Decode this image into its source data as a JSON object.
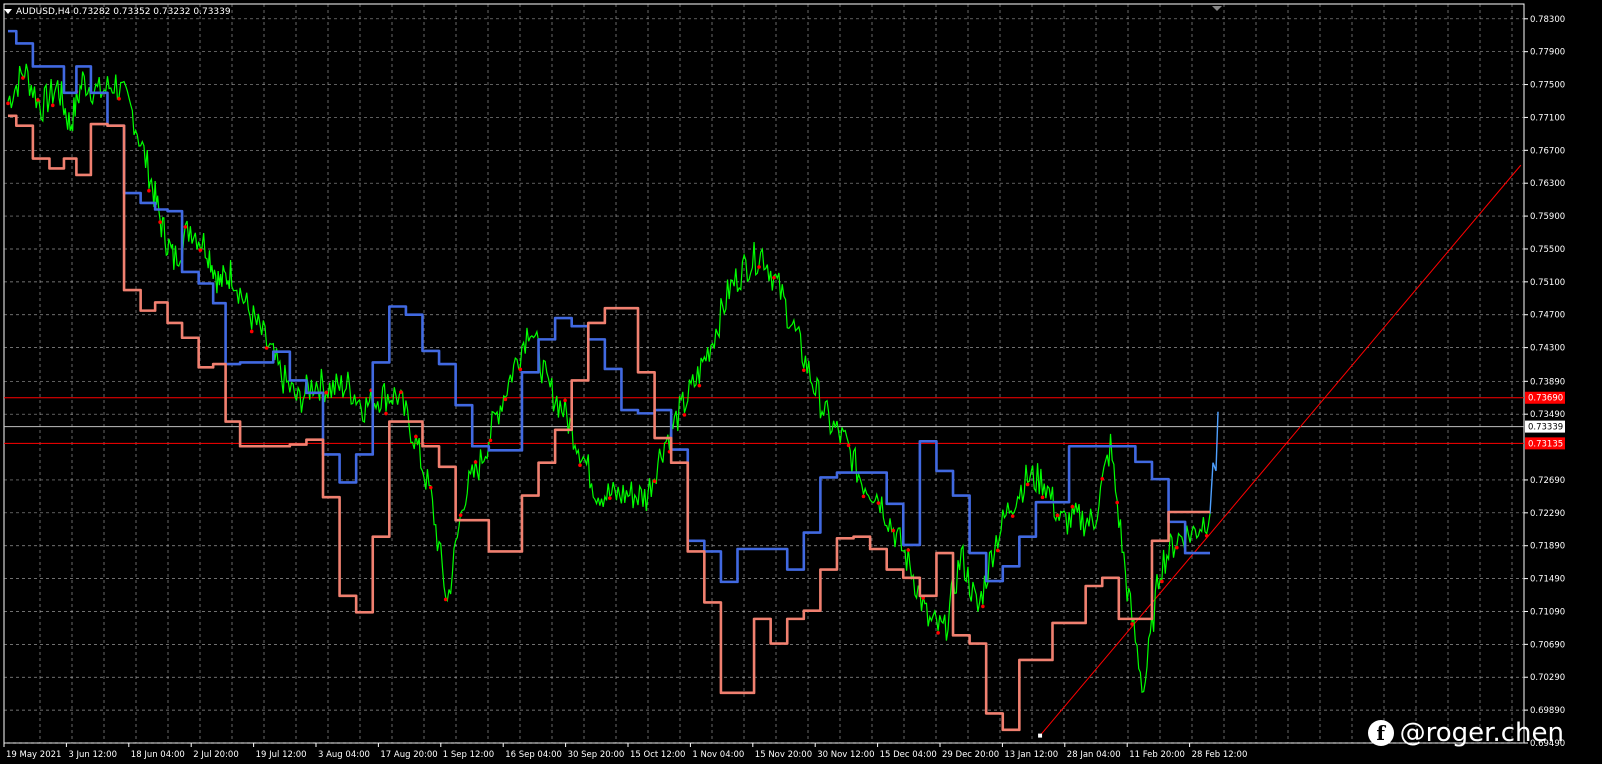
{
  "header": {
    "symbol": "AUDUSD,H4",
    "ohlc": "0.73282 0.73352 0.73232 0.73339"
  },
  "watermark": {
    "icon": "facebook-icon",
    "text": "@roger.chen"
  },
  "colors": {
    "background": "#000000",
    "grid": "#c8c8c8",
    "upper_channel": "#4169e1",
    "lower_channel": "#f08070",
    "price": "#00ff00",
    "signal_dots": "#ff0000",
    "hline": "#ff0000",
    "current_price": "#c0c0c0",
    "trendline": "#ff0000"
  },
  "chart_data": {
    "type": "line",
    "title": "",
    "xlabel": "",
    "ylabel": "",
    "ylim": [
      0.6949,
      0.7848
    ],
    "yticks": [
      "0.78300",
      "0.77900",
      "0.77500",
      "0.77100",
      "0.76700",
      "0.76300",
      "0.75900",
      "0.75500",
      "0.75100",
      "0.74700",
      "0.74300",
      "0.73890",
      "0.73490",
      "0.72690",
      "0.72290",
      "0.71890",
      "0.71490",
      "0.71090",
      "0.70690",
      "0.70290",
      "0.69890",
      "0.69490"
    ],
    "ytick_values": [
      0.783,
      0.779,
      0.775,
      0.771,
      0.767,
      0.763,
      0.759,
      0.755,
      0.751,
      0.747,
      0.743,
      0.7389,
      0.7349,
      0.7269,
      0.7229,
      0.7189,
      0.7149,
      0.7109,
      0.7069,
      0.7029,
      0.6989,
      0.6949
    ],
    "xticks": [
      "19 May 2021",
      "3 Jun 12:00",
      "18 Jun 04:00",
      "2 Jul 20:00",
      "19 Jul 12:00",
      "3 Aug 04:00",
      "17 Aug 20:00",
      "1 Sep 12:00",
      "16 Sep 04:00",
      "30 Sep 20:00",
      "15 Oct 12:00",
      "1 Nov 04:00",
      "15 Nov 20:00",
      "30 Nov 12:00",
      "15 Dec 04:00",
      "29 Dec 20:00",
      "13 Jan 12:00",
      "28 Jan 04:00",
      "11 Feb 20:00",
      "28 Feb 12:00"
    ],
    "x_index_max": 300,
    "grid": true,
    "horizontal_lines": [
      {
        "label": "0.73690",
        "value": 0.7369,
        "color": "#ff0000"
      },
      {
        "label": "0.73339",
        "value": 0.73339,
        "color": "#c0c0c0"
      },
      {
        "label": "0.73135",
        "value": 0.73135,
        "color": "#ff0000"
      }
    ],
    "trendline": {
      "from": [
        249,
        0.6958
      ],
      "to": [
        365,
        0.7652
      ]
    },
    "series": [
      {
        "key": "price",
        "color": "#00ff00",
        "x": [
          0,
          4,
          8,
          12,
          15,
          18,
          22,
          26,
          30,
          34,
          37,
          40,
          44,
          48,
          51,
          54,
          58,
          62,
          66,
          70,
          74,
          78,
          82,
          86,
          90,
          94,
          98,
          102,
          106,
          110,
          114,
          118,
          122,
          126,
          130,
          134,
          138,
          142,
          146,
          150,
          154,
          158,
          162,
          166,
          170,
          174,
          178,
          182,
          186,
          190,
          194,
          198,
          202,
          206,
          210,
          214,
          218,
          222,
          226,
          230,
          234,
          238,
          242,
          246,
          250,
          254,
          258,
          262,
          266,
          270,
          274,
          278,
          282,
          286,
          290
        ],
        "y": [
          0.773,
          0.7768,
          0.7722,
          0.7748,
          0.77,
          0.7755,
          0.774,
          0.7752,
          0.7716,
          0.7644,
          0.758,
          0.7536,
          0.7578,
          0.7552,
          0.7508,
          0.7522,
          0.7475,
          0.744,
          0.7395,
          0.7365,
          0.7388,
          0.738,
          0.7384,
          0.7358,
          0.7372,
          0.7372,
          0.7322,
          0.725,
          0.712,
          0.725,
          0.729,
          0.735,
          0.7405,
          0.746,
          0.7385,
          0.7354,
          0.7308,
          0.7255,
          0.725,
          0.7252,
          0.7248,
          0.731,
          0.735,
          0.739,
          0.744,
          0.75,
          0.753,
          0.7545,
          0.7502,
          0.7447,
          0.739,
          0.734,
          0.7315,
          0.7268,
          0.725,
          0.7205,
          0.716,
          0.7097,
          0.7085,
          0.7178,
          0.711,
          0.7192,
          0.724,
          0.7272,
          0.7268,
          0.7218,
          0.7222,
          0.7218,
          0.731,
          0.7138,
          0.7012,
          0.7165,
          0.7198,
          0.7205,
          0.7228
        ]
      },
      {
        "key": "upper",
        "color": "#4169e1",
        "x": [
          0,
          4,
          8,
          12,
          15,
          18,
          22,
          26,
          30,
          34,
          37,
          40,
          44,
          48,
          51,
          54,
          58,
          62,
          66,
          70,
          74,
          78,
          82,
          86,
          90,
          94,
          98,
          102,
          106,
          110,
          114,
          118,
          122,
          126,
          130,
          134,
          138,
          142,
          146,
          150,
          154,
          158,
          162,
          166,
          170,
          174,
          178,
          182,
          186,
          190,
          194,
          198,
          202,
          206,
          210,
          214,
          218,
          222,
          226,
          230,
          234,
          238,
          242,
          246,
          250,
          254,
          258,
          262,
          266,
          270,
          274,
          278,
          282,
          286,
          290
        ],
        "y": [
          0.7815,
          0.78,
          0.7772,
          0.7772,
          0.774,
          0.7772,
          0.774,
          0.77,
          0.7618,
          0.7606,
          0.7598,
          0.7596,
          0.7522,
          0.7508,
          0.7484,
          0.741,
          0.7412,
          0.7412,
          0.7425,
          0.739,
          0.7375,
          0.73,
          0.7266,
          0.73,
          0.7412,
          0.748,
          0.747,
          0.7426,
          0.741,
          0.736,
          0.731,
          0.7305,
          0.7305,
          0.74,
          0.744,
          0.7466,
          0.7456,
          0.744,
          0.7404,
          0.7354,
          0.735,
          0.7354,
          0.7306,
          0.7195,
          0.7182,
          0.7145,
          0.7185,
          0.7185,
          0.7185,
          0.716,
          0.7205,
          0.7272,
          0.7278,
          0.7278,
          0.7278,
          0.724,
          0.719,
          0.7316,
          0.728,
          0.725,
          0.718,
          0.7146,
          0.7164,
          0.72,
          0.7242,
          0.7242,
          0.731,
          0.731,
          0.731,
          0.731,
          0.7291,
          0.727,
          0.7218,
          0.718,
          0.718
        ]
      },
      {
        "key": "lower",
        "color": "#f08070",
        "x": [
          0,
          4,
          8,
          12,
          15,
          18,
          22,
          26,
          30,
          34,
          37,
          40,
          44,
          48,
          51,
          54,
          58,
          62,
          66,
          70,
          74,
          78,
          82,
          86,
          90,
          94,
          98,
          102,
          106,
          110,
          114,
          118,
          122,
          126,
          130,
          134,
          138,
          142,
          146,
          150,
          154,
          158,
          162,
          166,
          170,
          174,
          178,
          182,
          186,
          190,
          194,
          198,
          202,
          206,
          210,
          214,
          218,
          222,
          226,
          230,
          234,
          238,
          242,
          246,
          250,
          254,
          258,
          262,
          266,
          270,
          274,
          278,
          282,
          286,
          290
        ],
        "y": [
          0.7712,
          0.77,
          0.766,
          0.7648,
          0.766,
          0.764,
          0.7702,
          0.77,
          0.75,
          0.7475,
          0.7485,
          0.746,
          0.7442,
          0.7406,
          0.741,
          0.734,
          0.731,
          0.731,
          0.731,
          0.7312,
          0.7318,
          0.7248,
          0.7128,
          0.7108,
          0.72,
          0.734,
          0.734,
          0.731,
          0.7285,
          0.722,
          0.722,
          0.7182,
          0.7182,
          0.725,
          0.729,
          0.733,
          0.739,
          0.746,
          0.7478,
          0.7478,
          0.74,
          0.732,
          0.729,
          0.7182,
          0.712,
          0.701,
          0.701,
          0.71,
          0.707,
          0.71,
          0.711,
          0.716,
          0.7198,
          0.72,
          0.7185,
          0.716,
          0.715,
          0.7128,
          0.718,
          0.708,
          0.707,
          0.6985,
          0.6965,
          0.705,
          0.705,
          0.7095,
          0.7095,
          0.714,
          0.715,
          0.71,
          0.71,
          0.7195,
          0.723,
          0.723,
          0.723
        ]
      }
    ]
  }
}
